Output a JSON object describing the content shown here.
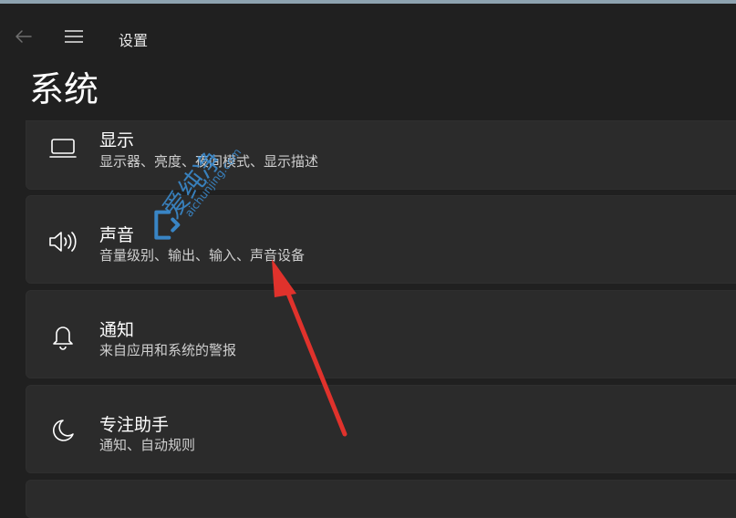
{
  "app": {
    "title": "设置"
  },
  "page": {
    "title": "系统"
  },
  "cards": [
    {
      "title": "显示",
      "desc": "显示器、亮度、夜间模式、显示描述",
      "icon": "display-icon"
    },
    {
      "title": "声音",
      "desc": "音量级别、输出、输入、声音设备",
      "icon": "speaker-icon"
    },
    {
      "title": "通知",
      "desc": "来自应用和系统的警报",
      "icon": "bell-icon"
    },
    {
      "title": "专注助手",
      "desc": "通知、自动规则",
      "icon": "moon-icon"
    }
  ],
  "watermark": {
    "text": "爱纯净",
    "url": "aichunjing.com"
  },
  "colors": {
    "background": "#202020",
    "card": "#2b2b2b",
    "annotation_arrow": "#e0322c",
    "watermark": "#3b8fd6"
  }
}
